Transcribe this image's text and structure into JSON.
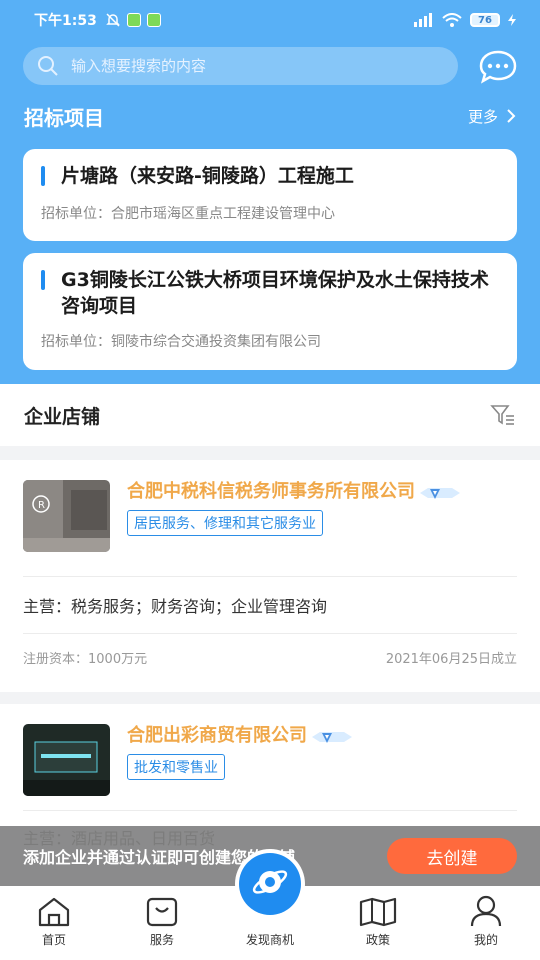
{
  "status_bar": {
    "time": "下午1:53",
    "battery": "76"
  },
  "search": {
    "placeholder": "输入想要搜索的内容"
  },
  "tender_section": {
    "title": "招标项目",
    "more_label": "更多",
    "items": [
      {
        "title": "片塘路（来安路-铜陵路）工程施工",
        "unit": "招标单位：合肥市瑶海区重点工程建设管理中心"
      },
      {
        "title": "G3铜陵长江公铁大桥项目环境保护及水土保持技术咨询项目",
        "unit": "招标单位：铜陵市综合交通投资集团有限公司"
      }
    ]
  },
  "shop_section": {
    "title": "企业店铺",
    "shops": [
      {
        "name": "合肥中税科信税务师事务所有限公司",
        "tag": "居民服务、修理和其它服务业",
        "main": "主营：税务服务；财务咨询；企业管理咨询",
        "capital": "注册资本：1000万元",
        "date": "2021年06月25日成立"
      },
      {
        "name": "合肥出彩商贸有限公司",
        "tag": "批发和零售业",
        "main": "主营：酒店用品、日用百货"
      }
    ]
  },
  "banner": {
    "text": "添加企业并通过认证即可创建您的店铺",
    "button": "去创建"
  },
  "tabs": [
    {
      "label": "首页",
      "icon": "home-icon"
    },
    {
      "label": "服务",
      "icon": "bag-icon"
    },
    {
      "label": "发现商机",
      "icon": "planet-icon"
    },
    {
      "label": "政策",
      "icon": "book-icon"
    },
    {
      "label": "我的",
      "icon": "user-icon"
    }
  ],
  "colors": {
    "header_blue": "#58b0f6",
    "accent_blue": "#1f8cf0",
    "shop_name_orange": "#f0a84a",
    "create_button": "#ff6a3d"
  }
}
